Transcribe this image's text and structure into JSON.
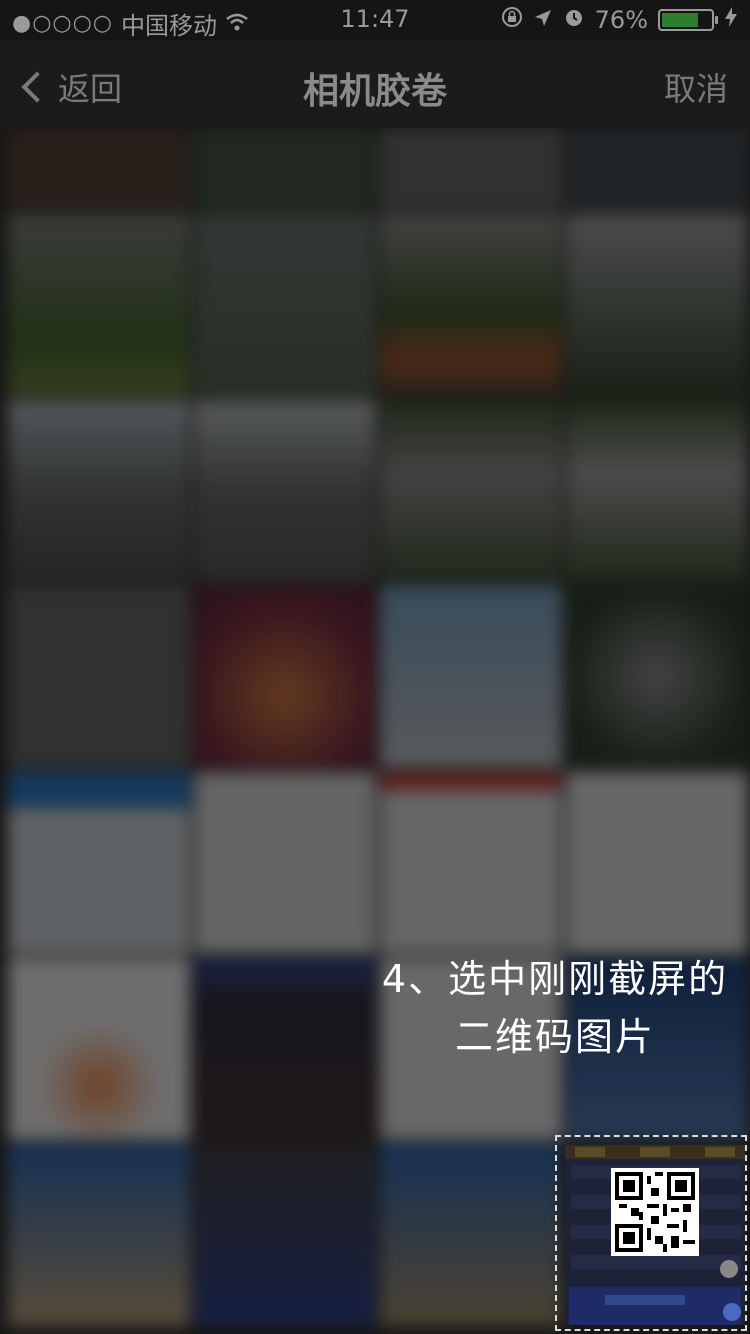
{
  "status": {
    "carrier": "中国移动",
    "signal_dots": "●○○○○",
    "time": "11:47",
    "battery": "76%",
    "battery_level": 0.76,
    "battery_color": "#2f7d2f"
  },
  "nav": {
    "back_label": "返回",
    "title": "相机胶卷",
    "cancel_label": "取消"
  },
  "instruction": {
    "line1": "4、选中刚刚截屏的",
    "line2": "二维码图片"
  },
  "icons": {
    "wifi": "wifi-icon",
    "lock": "rotation-lock-icon",
    "location": "location-arrow-icon",
    "alarm": "alarm-icon",
    "charging": "charging-bolt-icon",
    "back": "chevron-left-icon"
  }
}
